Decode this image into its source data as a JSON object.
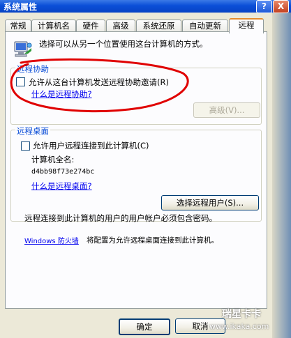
{
  "window": {
    "title": "系统属性",
    "help_glyph": "?",
    "close_glyph": "X"
  },
  "tabs": [
    "常规",
    "计算机名",
    "硬件",
    "高级",
    "系统还原",
    "自动更新",
    "远程"
  ],
  "intro_text": "选择可以从另一个位置使用这台计算机的方式。",
  "remote_assistance": {
    "legend": "远程协助",
    "checkbox_label": "允许从这台计算机发送远程协助邀请(R)",
    "checkbox_checked": false,
    "link": "什么是远程协助?",
    "advanced_button": "高级(V)..."
  },
  "remote_desktop": {
    "legend": "远程桌面",
    "checkbox_label": "允许用户远程连接到此计算机(C)",
    "checkbox_checked": false,
    "full_name_label": "计算机全名:",
    "computer_name": "d4bb98f73e274bc",
    "link": "什么是远程桌面?",
    "select_users_button": "选择远程用户(S)...",
    "note": "远程连接到此计算机的用户的用户帐户必须包含密码。",
    "firewall_link": "Windows 防火墙",
    "firewall_text": "将配置为允许远程桌面连接到此计算机。"
  },
  "footer": {
    "ok": "确定",
    "cancel": "取消"
  },
  "watermark": {
    "brand": "瑞星卡卡",
    "url": "www.ikaka.com"
  },
  "annotation_color": "#e00000"
}
